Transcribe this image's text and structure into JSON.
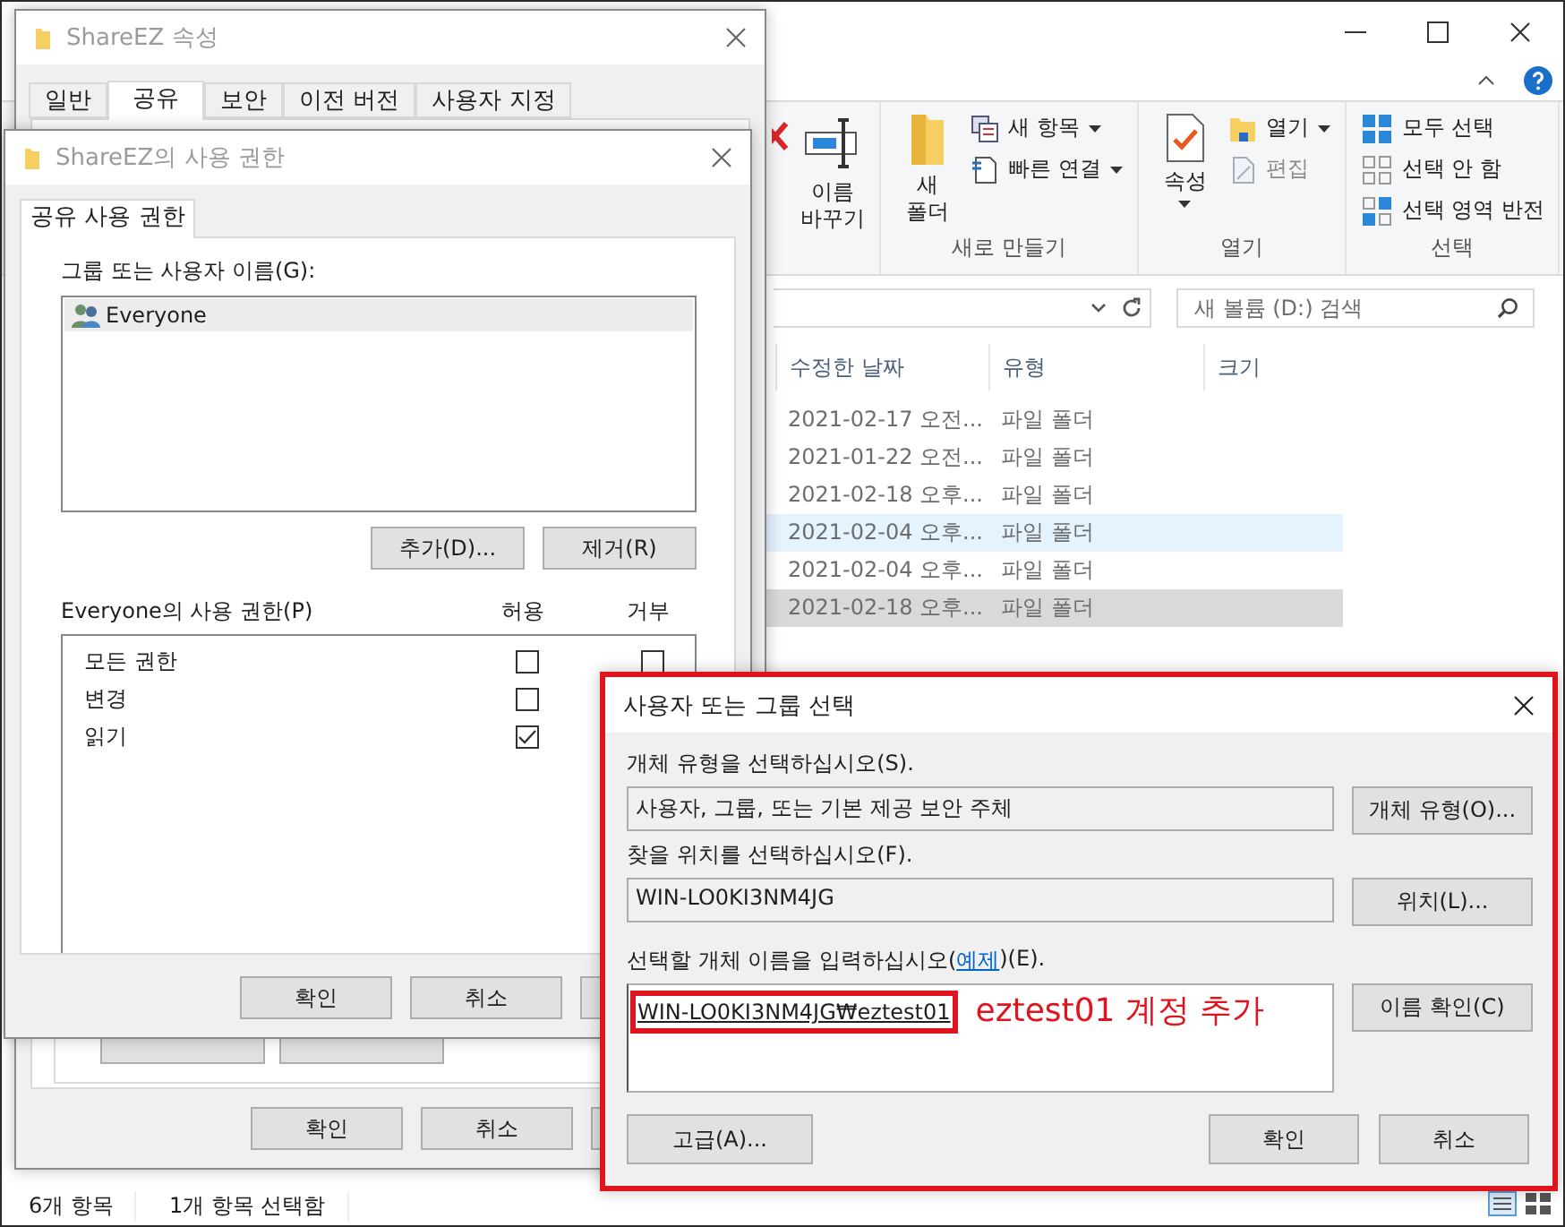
{
  "explorer": {
    "ribbon": {
      "groups": [
        {
          "items": [
            {
              "kind": "large",
              "label": "이름\n바꾸기"
            }
          ]
        },
        {
          "label": "새로 만들기",
          "items": [
            {
              "kind": "large",
              "label": "새\n폴더"
            },
            {
              "kind": "small",
              "label": "새 항목",
              "dropdown": true
            },
            {
              "kind": "small",
              "label": "빠른 연결",
              "dropdown": true
            }
          ]
        },
        {
          "label": "열기",
          "items": [
            {
              "kind": "large",
              "label": "속성",
              "dropdown": true
            },
            {
              "kind": "small",
              "label": "열기",
              "dropdown": true
            },
            {
              "kind": "small",
              "label": "편집",
              "disabled": true
            }
          ]
        },
        {
          "label": "선택",
          "items": [
            {
              "kind": "small",
              "label": "모두 선택"
            },
            {
              "kind": "small",
              "label": "선택 안 함"
            },
            {
              "kind": "small",
              "label": "선택 영역 반전"
            }
          ]
        }
      ]
    },
    "search": {
      "placeholder": "새 볼륨 (D:) 검색"
    },
    "columns": [
      "수정한 날짜",
      "유형",
      "크기"
    ],
    "rows": [
      {
        "cells": [
          "2021-02-17 오전...",
          "파일 폴더"
        ],
        "selected": false,
        "hovered": false
      },
      {
        "cells": [
          "2021-01-22 오전...",
          "파일 폴더"
        ],
        "selected": false,
        "hovered": false
      },
      {
        "cells": [
          "2021-02-18 오후...",
          "파일 폴더"
        ],
        "selected": false,
        "hovered": false
      },
      {
        "cells": [
          "2021-02-04 오후...",
          "파일 폴더"
        ],
        "selected": false,
        "hovered": true
      },
      {
        "cells": [
          "2021-02-04 오후...",
          "파일 폴더"
        ],
        "selected": false,
        "hovered": false
      },
      {
        "cells": [
          "2021-02-18 오후...",
          "파일 폴더"
        ],
        "selected": true,
        "hovered": false
      }
    ],
    "status_bar": [
      "6개 항목",
      "1개 항목 선택함"
    ]
  },
  "properties_window": {
    "title": "ShareEZ 속성",
    "tabs": [
      {
        "label": "일반",
        "selected": false
      },
      {
        "label": "공유",
        "selected": true
      },
      {
        "label": "보안",
        "selected": false
      },
      {
        "label": "이전 버전",
        "selected": false
      },
      {
        "label": "사용자 지정",
        "selected": false
      }
    ],
    "buttons": [
      "확인",
      "취소"
    ]
  },
  "permissions_dialog": {
    "title": "ShareEZ의 사용 권한",
    "tabs": [
      {
        "label": "공유 사용 권한",
        "selected": true
      }
    ],
    "users_label": "그룹 또는 사용자 이름(G):",
    "users": [
      {
        "name": "Everyone",
        "selected": true
      }
    ],
    "user_buttons": [
      "추가(D)...",
      "제거(R)"
    ],
    "permissions_label": "Everyone의 사용 권한(P)",
    "allow_header": "허용",
    "deny_header": "거부",
    "permissions": [
      {
        "name": "모든 권한",
        "allow": false,
        "deny": false
      },
      {
        "name": "변경",
        "allow": false
      },
      {
        "name": "읽기",
        "allow": true
      }
    ],
    "buttons": [
      "확인",
      "취소"
    ]
  },
  "select_dialog": {
    "title": "사용자 또는 그룹 선택",
    "object_type_label": "개체 유형을 선택하십시오(S).",
    "object_type": "사용자, 그룹, 또는 기본 제공 보안 주체",
    "object_type_button": "개체 유형(O)...",
    "location_label": "찾을 위치를 선택하십시오(F).",
    "location": "WIN-LO0KI3NM4JG",
    "location_button": "위치(L)...",
    "names_label": "선택할 개체 이름을 입력하십시오(",
    "names_link": "예제",
    "names_label_end": ")(E).",
    "entered_name": "WIN-LO0KI3NM4JG₩eztest01",
    "check_names_button": "이름 확인(C)",
    "advanced_button": "고급(A)...",
    "ok_button": "확인",
    "cancel_button": "취소"
  },
  "annotation": {
    "text": "eztest01 계정 추가"
  }
}
